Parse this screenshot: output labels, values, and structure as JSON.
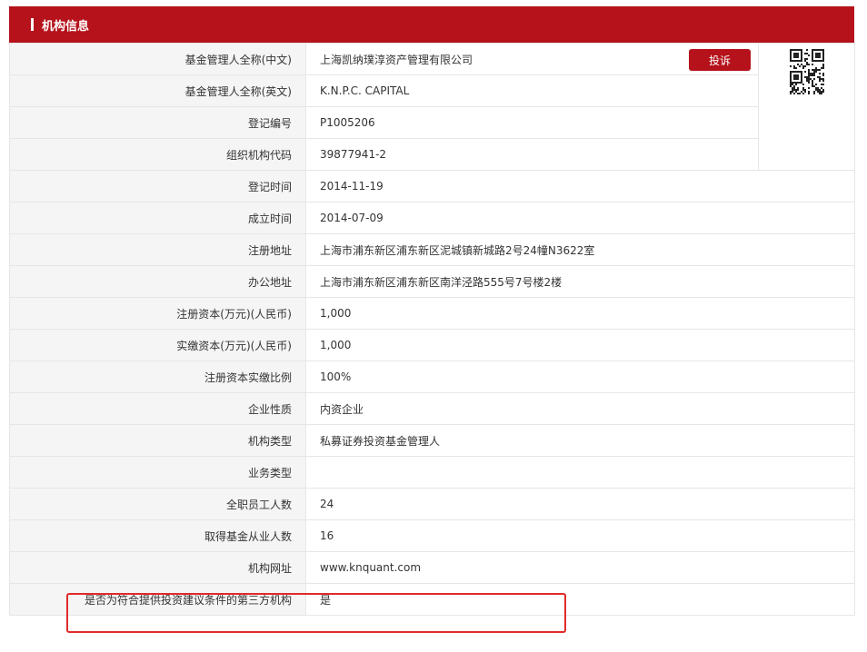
{
  "section": {
    "title": "机构信息",
    "accent_color": "#b5121b"
  },
  "complain_button": "投诉",
  "qr_icon": "qr-code-icon",
  "rows": [
    {
      "label": "基金管理人全称(中文)",
      "value": "上海凯纳璞淳资产管理有限公司"
    },
    {
      "label": "基金管理人全称(英文)",
      "value": "K.N.P.C. CAPITAL"
    },
    {
      "label": "登记编号",
      "value": "P1005206"
    },
    {
      "label": "组织机构代码",
      "value": "39877941-2"
    },
    {
      "label": "登记时间",
      "value": "2014-11-19"
    },
    {
      "label": "成立时间",
      "value": "2014-07-09"
    },
    {
      "label": "注册地址",
      "value": "上海市浦东新区浦东新区泥城镇新城路2号24幢N3622室"
    },
    {
      "label": "办公地址",
      "value": "上海市浦东新区浦东新区南洋泾路555号7号楼2楼"
    },
    {
      "label": "注册资本(万元)(人民币)",
      "value": "1,000"
    },
    {
      "label": "实缴资本(万元)(人民币)",
      "value": "1,000"
    },
    {
      "label": "注册资本实缴比例",
      "value": "100%"
    },
    {
      "label": "企业性质",
      "value": "内资企业"
    },
    {
      "label": "机构类型",
      "value": "私募证券投资基金管理人"
    },
    {
      "label": "业务类型",
      "value": ""
    },
    {
      "label": "全职员工人数",
      "value": "24"
    },
    {
      "label": "取得基金从业人数",
      "value": "16"
    },
    {
      "label": "机构网址",
      "value": "www.knquant.com"
    },
    {
      "label": "是否为符合提供投资建议条件的第三方机构",
      "value": "是"
    }
  ]
}
